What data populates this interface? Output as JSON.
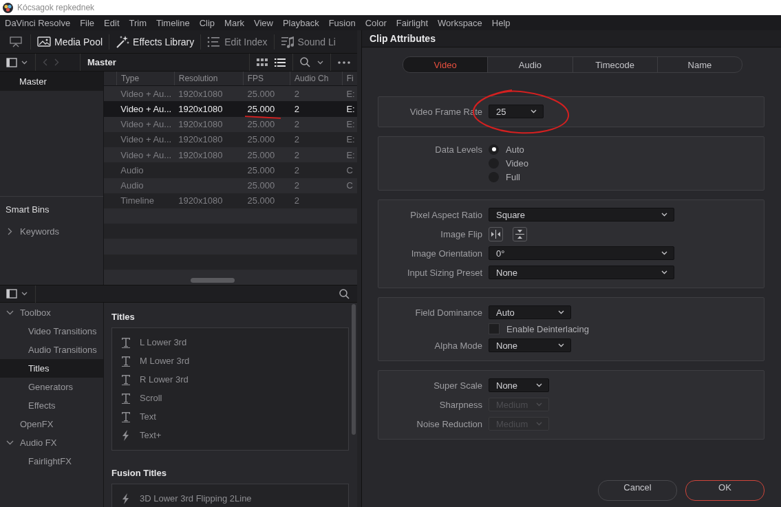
{
  "window": {
    "title": "Kócsagok repkednek"
  },
  "menu": [
    "DaVinci Resolve",
    "File",
    "Edit",
    "Trim",
    "Timeline",
    "Clip",
    "Mark",
    "View",
    "Playback",
    "Fusion",
    "Color",
    "Fairlight",
    "Workspace",
    "Help"
  ],
  "toolbar": [
    {
      "label": "Media Pool",
      "kind": "media",
      "on": true
    },
    {
      "label": "Effects Library",
      "kind": "effects",
      "on": true
    },
    {
      "label": "Edit Index",
      "kind": "index",
      "on": false
    },
    {
      "label": "Sound Li",
      "kind": "sound",
      "on": false
    }
  ],
  "media_pool": {
    "bin_path": "Master",
    "bins": [
      {
        "label": "Master",
        "selected": true
      }
    ],
    "smart_bins_title": "Smart Bins",
    "smart_bins": [
      {
        "label": "Keywords",
        "expanded": false
      }
    ],
    "table": {
      "columns": [
        "Type",
        "Resolution",
        "FPS",
        "Audio Ch",
        "Fi"
      ],
      "rows": [
        {
          "cells": [
            "Video + Au...",
            "1920x1080",
            "25.000",
            "2",
            "E:"
          ],
          "selected": false
        },
        {
          "cells": [
            "Video + Au...",
            "1920x1080",
            "25.000",
            "2",
            "E:"
          ],
          "selected": true
        },
        {
          "cells": [
            "Video + Au...",
            "1920x1080",
            "25.000",
            "2",
            "E:"
          ],
          "selected": false
        },
        {
          "cells": [
            "Video + Au...",
            "1920x1080",
            "25.000",
            "2",
            "E:"
          ],
          "selected": false
        },
        {
          "cells": [
            "Video + Au...",
            "1920x1080",
            "25.000",
            "2",
            "E:"
          ],
          "selected": false
        },
        {
          "cells": [
            "Audio",
            "",
            "25.000",
            "2",
            "C"
          ],
          "selected": false
        },
        {
          "cells": [
            "Audio",
            "",
            "25.000",
            "2",
            "C"
          ],
          "selected": false
        },
        {
          "cells": [
            "Timeline",
            "1920x1080",
            "25.000",
            "2",
            ""
          ],
          "selected": false
        }
      ]
    }
  },
  "effects": {
    "tree": [
      {
        "label": "Toolbox",
        "expanded": true,
        "selected": false,
        "children": [
          {
            "label": "Video Transitions",
            "selected": false
          },
          {
            "label": "Audio Transitions",
            "selected": false
          },
          {
            "label": "Titles",
            "selected": true
          },
          {
            "label": "Generators",
            "selected": false
          },
          {
            "label": "Effects",
            "selected": false
          }
        ]
      },
      {
        "label": "OpenFX",
        "selected": false
      },
      {
        "label": "Audio FX",
        "expanded": true,
        "selected": false,
        "children": [
          {
            "label": "FairlightFX",
            "selected": false
          }
        ]
      }
    ],
    "sections": [
      {
        "title": "Titles",
        "items": [
          {
            "label": "L Lower 3rd",
            "kind": "title"
          },
          {
            "label": "M Lower 3rd",
            "kind": "title"
          },
          {
            "label": "R Lower 3rd",
            "kind": "title"
          },
          {
            "label": "Scroll",
            "kind": "title"
          },
          {
            "label": "Text",
            "kind": "title"
          },
          {
            "label": "Text+",
            "kind": "fusion"
          }
        ]
      },
      {
        "title": "Fusion Titles",
        "items": [
          {
            "label": "3D Lower 3rd Flipping 2Line",
            "kind": "fusion"
          }
        ]
      }
    ]
  },
  "dialog": {
    "title": "Clip Attributes",
    "tabs": [
      {
        "label": "Video",
        "selected": true
      },
      {
        "label": "Audio",
        "selected": false
      },
      {
        "label": "Timecode",
        "selected": false
      },
      {
        "label": "Name",
        "selected": false
      }
    ],
    "groups": [
      {
        "rows": [
          {
            "kind": "select",
            "label": "Video Frame Rate",
            "value": "25",
            "disabled": false
          }
        ]
      },
      {
        "rows": [
          {
            "kind": "radio",
            "label": "Data Levels",
            "options": [
              {
                "label": "Auto",
                "selected": true
              },
              {
                "label": "Video",
                "selected": false
              },
              {
                "label": "Full",
                "selected": false
              }
            ]
          }
        ]
      },
      {
        "rows": [
          {
            "kind": "select",
            "label": "Pixel Aspect Ratio",
            "value": "Square",
            "disabled": false
          },
          {
            "kind": "flip",
            "label": "Image Flip"
          },
          {
            "kind": "select",
            "label": "Image Orientation",
            "value": "0°",
            "disabled": false
          },
          {
            "kind": "select",
            "label": "Input Sizing Preset",
            "value": "None",
            "disabled": false
          }
        ]
      },
      {
        "rows": [
          {
            "kind": "select",
            "label": "Field Dominance",
            "value": "Auto",
            "disabled": false
          },
          {
            "kind": "checkbox",
            "text": "Enable Deinterlacing",
            "checked": false
          },
          {
            "kind": "select",
            "label": "Alpha Mode",
            "value": "None",
            "disabled": false
          }
        ]
      },
      {
        "rows": [
          {
            "kind": "select",
            "label": "Super Scale",
            "value": "None",
            "disabled": false
          },
          {
            "kind": "select",
            "label": "Sharpness",
            "value": "Medium",
            "disabled": true
          },
          {
            "kind": "select",
            "label": "Noise Reduction",
            "value": "Medium",
            "disabled": true
          }
        ]
      }
    ],
    "buttons": [
      {
        "label": "Cancel",
        "kind": "secondary"
      },
      {
        "label": "OK",
        "kind": "primary"
      }
    ]
  }
}
